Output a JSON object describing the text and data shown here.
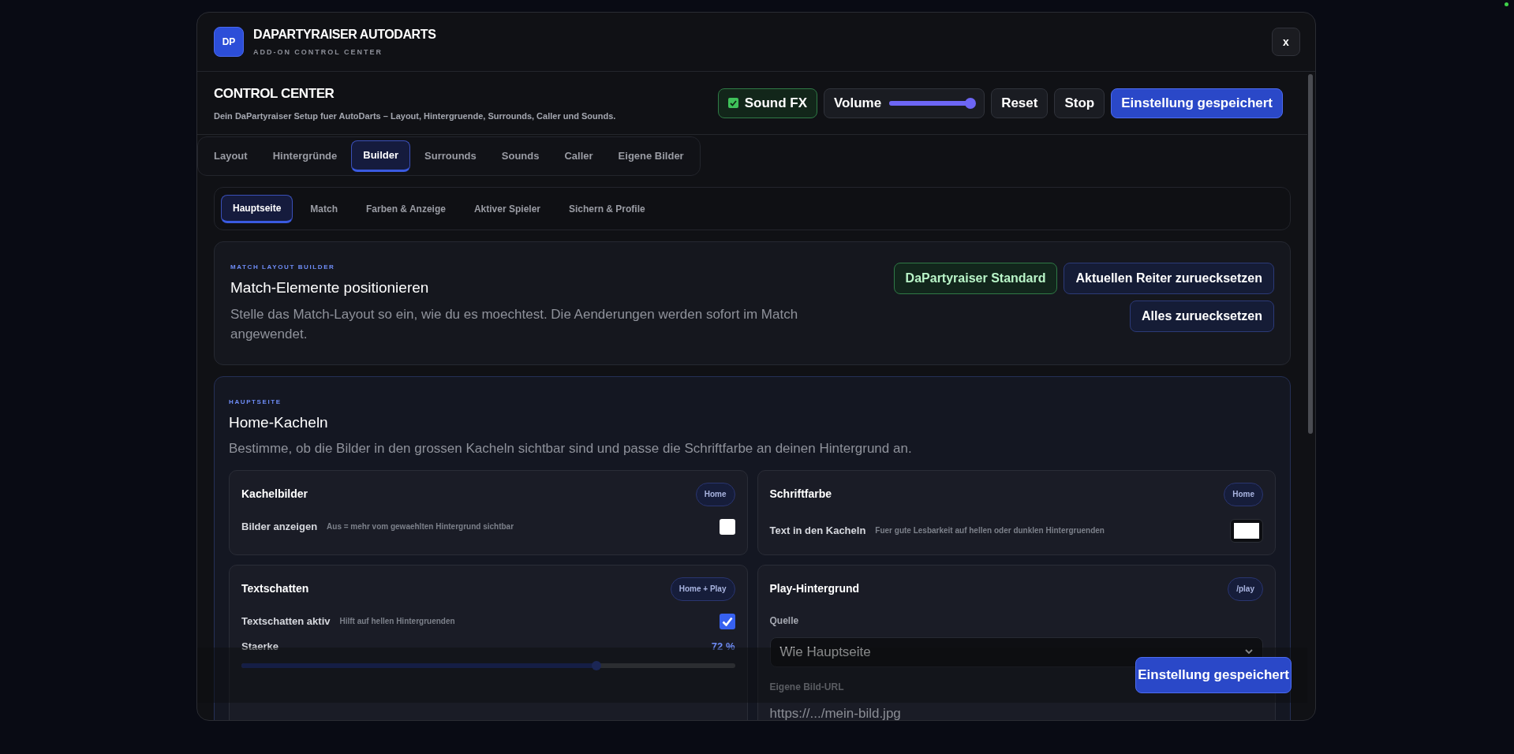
{
  "app": {
    "logo": "DP",
    "title": "DAPARTYRAISER AUTODARTS",
    "subtitle": "ADD-ON CONTROL CENTER",
    "close": "x"
  },
  "control_center": {
    "title": "CONTROL CENTER",
    "description": "Dein DaPartyraiser Setup fuer AutoDarts – Layout, Hintergruende, Surrounds, Caller und Sounds.",
    "sound_fx": {
      "label": "Sound FX",
      "checked": true
    },
    "volume": {
      "label": "Volume",
      "level": 0.95
    },
    "buttons": [
      {
        "label": "Reset",
        "kind": "plain"
      },
      {
        "label": "Stop",
        "kind": "plain"
      },
      {
        "label": "Einstellung gespeichert",
        "kind": "primary"
      }
    ]
  },
  "tabs": [
    {
      "label": "Layout",
      "selected": false
    },
    {
      "label": "Hintergründe",
      "selected": false
    },
    {
      "label": "Builder",
      "selected": true
    },
    {
      "label": "Surrounds",
      "selected": false
    },
    {
      "label": "Sounds",
      "selected": false
    },
    {
      "label": "Caller",
      "selected": false
    },
    {
      "label": "Eigene Bilder",
      "selected": false
    }
  ],
  "subtabs": [
    {
      "label": "Hauptseite",
      "selected": true
    },
    {
      "label": "Match",
      "selected": false
    },
    {
      "label": "Farben & Anzeige",
      "selected": false
    },
    {
      "label": "Aktiver Spieler",
      "selected": false
    },
    {
      "label": "Sichern & Profile",
      "selected": false
    }
  ],
  "layout_builder": {
    "eyebrow": "MATCH LAYOUT BUILDER",
    "title": "Match-Elemente positionieren",
    "description": "Stelle das Match-Layout so ein, wie du es moechtest. Die Aenderungen werden sofort im Match angewendet.",
    "buttons": [
      {
        "label": "DaPartyraiser Standard",
        "kind": "success"
      },
      {
        "label": "Aktuellen Reiter zuruecksetzen",
        "kind": "outline"
      },
      {
        "label": "Alles zuruecksetzen",
        "kind": "outline"
      }
    ]
  },
  "section": {
    "eyebrow": "HAUPTSEITE",
    "title": "Home-Kacheln",
    "description": "Bestimme, ob die Bilder in den grossen Kacheln sichtbar sind und passe die Schriftfarbe an deinen Hintergrund an.",
    "cards": [
      {
        "title": "Kachelbilder",
        "badge": "Home",
        "rows": [
          {
            "kind": "checkbox",
            "label": "Bilder anzeigen",
            "hint": "Aus = mehr vom gewaehlten Hintergrund sichtbar",
            "checked": false
          }
        ]
      },
      {
        "title": "Schriftfarbe",
        "badge": "Home",
        "rows": [
          {
            "kind": "color",
            "label": "Text in den Kacheln",
            "hint": "Fuer gute Lesbarkeit auf hellen oder dunklen Hintergruenden",
            "color": "#ffffff"
          }
        ]
      },
      {
        "title": "Textschatten",
        "badge": "Home + Play",
        "rows": [
          {
            "kind": "checkbox",
            "label": "Textschatten aktiv",
            "hint": "Hilft auf hellen Hintergruenden",
            "checked": true
          },
          {
            "kind": "slider",
            "label": "Staerke",
            "reading": "72 %",
            "level": 0.72
          }
        ]
      },
      {
        "title": "Play-Hintergrund",
        "badge": "/play",
        "rows": [
          {
            "kind": "select",
            "label": "Quelle",
            "value": "Wie Hauptseite"
          },
          {
            "kind": "input",
            "label": "Eigene Bild-URL",
            "placeholder": "https://.../mein-bild.jpg"
          }
        ]
      }
    ]
  },
  "footer": {
    "save": "Einstellung gespeichert"
  }
}
